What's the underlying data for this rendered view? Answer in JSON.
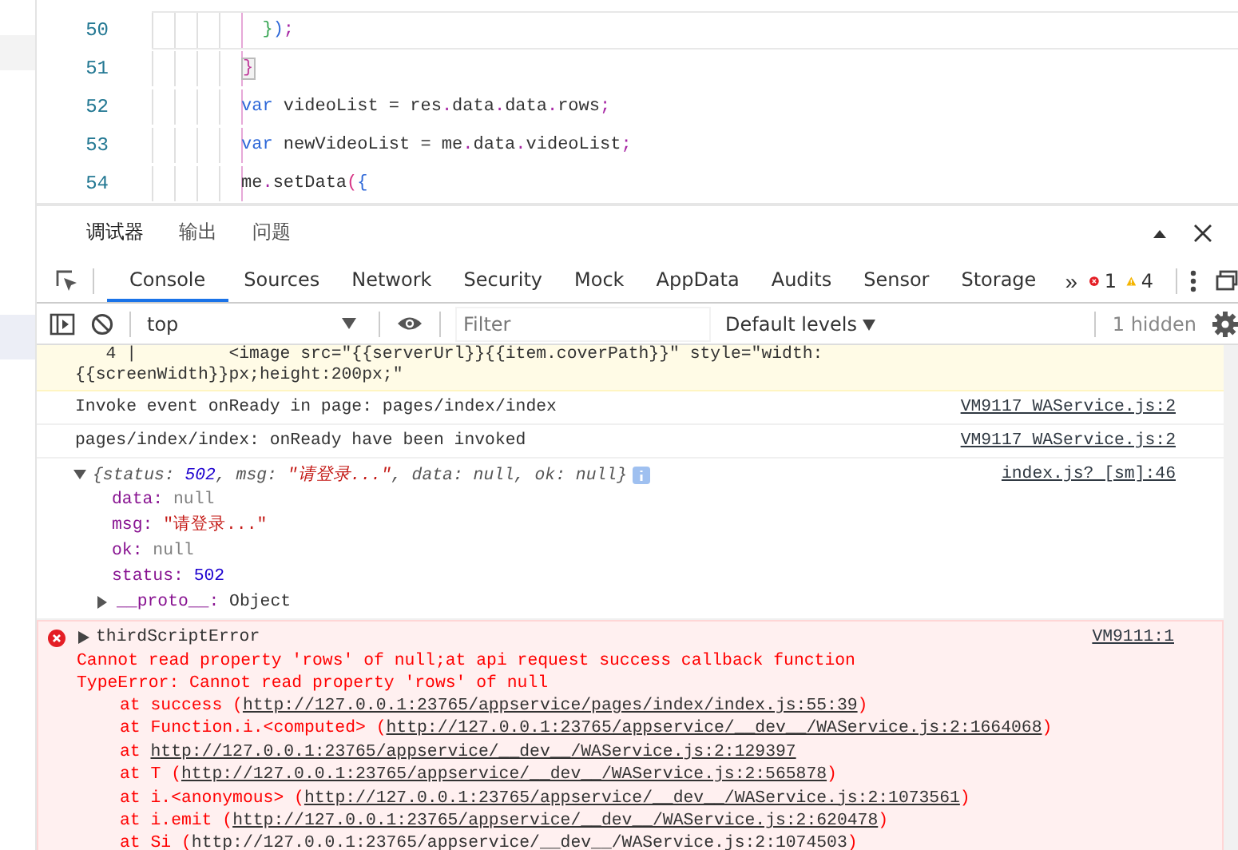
{
  "editor": {
    "lines": [
      {
        "number": "50",
        "current": true,
        "tokens": [
          {
            "text": "  }",
            "kind": "green"
          },
          {
            "text": ")",
            "kind": "blue"
          },
          {
            "text": ";",
            "kind": "punct"
          }
        ]
      },
      {
        "number": "51",
        "current": false,
        "tokens": [
          {
            "text": "}",
            "kind": "boxed"
          }
        ]
      },
      {
        "number": "52",
        "current": false,
        "tokens": [
          {
            "text": "var",
            "kind": "keyword"
          },
          {
            "text": " videoList = res",
            "kind": "plain"
          },
          {
            "text": ".",
            "kind": "punct"
          },
          {
            "text": "data",
            "kind": "plain"
          },
          {
            "text": ".",
            "kind": "punct"
          },
          {
            "text": "data",
            "kind": "plain"
          },
          {
            "text": ".",
            "kind": "punct"
          },
          {
            "text": "rows",
            "kind": "plain"
          },
          {
            "text": ";",
            "kind": "punct"
          }
        ]
      },
      {
        "number": "53",
        "current": false,
        "tokens": [
          {
            "text": "var",
            "kind": "keyword"
          },
          {
            "text": " newVideoList = me",
            "kind": "plain"
          },
          {
            "text": ".",
            "kind": "punct"
          },
          {
            "text": "data",
            "kind": "plain"
          },
          {
            "text": ".",
            "kind": "punct"
          },
          {
            "text": "videoList",
            "kind": "plain"
          },
          {
            "text": ";",
            "kind": "punct"
          }
        ]
      },
      {
        "number": "54",
        "current": false,
        "tokens": [
          {
            "text": "me",
            "kind": "plain"
          },
          {
            "text": ".",
            "kind": "punct"
          },
          {
            "text": "setData",
            "kind": "plain"
          },
          {
            "text": "(",
            "kind": "pink"
          },
          {
            "text": "{",
            "kind": "blue"
          }
        ]
      }
    ]
  },
  "panel_tabs": [
    {
      "label": "调试器",
      "selected": true
    },
    {
      "label": "输出",
      "selected": false
    },
    {
      "label": "问题",
      "selected": false
    }
  ],
  "devtools_tabs": [
    {
      "label": "Console",
      "selected": true
    },
    {
      "label": "Sources",
      "selected": false
    },
    {
      "label": "Network",
      "selected": false
    },
    {
      "label": "Security",
      "selected": false
    },
    {
      "label": "Mock",
      "selected": false
    },
    {
      "label": "AppData",
      "selected": false
    },
    {
      "label": "Audits",
      "selected": false
    },
    {
      "label": "Sensor",
      "selected": false
    },
    {
      "label": "Storage",
      "selected": false
    }
  ],
  "more_tabs": "»",
  "error_count": "1",
  "warning_count": "4",
  "toolbar": {
    "context": "top",
    "filter_placeholder": "Filter",
    "levels": "Default levels",
    "hidden": "1 hidden"
  },
  "messages": [
    {
      "kind": "warning",
      "lines": [
        "   4 |         <image src=\"{{serverUrl}}{{item.coverPath}}\" style=\"width:",
        "{{screenWidth}}px;height:200px;\""
      ]
    },
    {
      "kind": "log",
      "text": "Invoke event onReady in page: pages/index/index",
      "source": "VM9117 WAService.js:2"
    },
    {
      "kind": "log",
      "text": "pages/index/index: onReady have been invoked",
      "source": "VM9117 WAService.js:2"
    },
    {
      "kind": "object",
      "expanded": true,
      "source": "index.js? [sm]:46",
      "summary": [
        {
          "text": "{status: ",
          "kind": "key"
        },
        {
          "text": "502",
          "kind": "number"
        },
        {
          "text": ", msg: ",
          "kind": "key"
        },
        {
          "text": "\"请登录...\"",
          "kind": "string"
        },
        {
          "text": ", data: null, ok: null}",
          "kind": "key"
        }
      ],
      "properties": [
        {
          "key": "data:",
          "value": "null",
          "kind": "null"
        },
        {
          "key": "msg:",
          "value": "\"请登录...\"",
          "kind": "string"
        },
        {
          "key": "ok:",
          "value": "null",
          "kind": "null"
        },
        {
          "key": "status:",
          "value": "502",
          "kind": "number"
        }
      ],
      "proto": {
        "key": "__proto__:",
        "value": "Object",
        "expanded": false
      }
    },
    {
      "kind": "error",
      "title": "thirdScriptError",
      "source": "VM9111:1",
      "lines": [
        "Cannot read property 'rows' of null;at api request success callback function",
        "TypeError: Cannot read property 'rows' of null"
      ],
      "stack": [
        {
          "before": "at success (",
          "url": "http://127.0.0.1:23765/appservice/pages/index/index.js:55:39",
          "after": ")",
          "underlined": true
        },
        {
          "before": "at Function.i.<computed> (",
          "url": "http://127.0.0.1:23765/appservice/__dev__/WAService.js:2:1664068",
          "after": ")",
          "underlined": true
        },
        {
          "before": "at ",
          "url": "http://127.0.0.1:23765/appservice/__dev__/WAService.js:2:129397",
          "underlined": true
        },
        {
          "before": "at T (",
          "url": "http://127.0.0.1:23765/appservice/__dev__/WAService.js:2:565878",
          "after": ")",
          "underlined": true
        },
        {
          "before": "at i.<anonymous> (",
          "url": "http://127.0.0.1:23765/appservice/__dev__/WAService.js:2:1073561",
          "after": ")",
          "underlined": true
        },
        {
          "before": "at i.emit (",
          "url": "http://127.0.0.1:23765/appservice/__dev__/WAService.js:2:620478",
          "after": ")",
          "underlined": true
        },
        {
          "before": "at Si (",
          "url": "http://127.0.0.1:23765/appservice/__dev__/WAService.js:2:1074503",
          "after": ")",
          "underlined": false
        }
      ]
    }
  ]
}
